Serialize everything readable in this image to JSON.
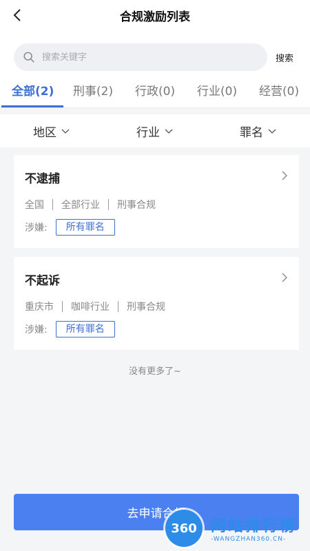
{
  "header": {
    "title": "合规激励列表",
    "back_icon": "chevron-left-icon"
  },
  "search": {
    "placeholder": "搜索关键字",
    "value": "",
    "button_label": "搜索",
    "icon": "search-icon"
  },
  "tabs": [
    {
      "label": "全部(2)",
      "active": true
    },
    {
      "label": "刑事(2)",
      "active": false
    },
    {
      "label": "行政(0)",
      "active": false
    },
    {
      "label": "行业(0)",
      "active": false
    },
    {
      "label": "经营(0)",
      "active": false
    }
  ],
  "filters": [
    {
      "label": "地区",
      "icon": "chevron-down-icon"
    },
    {
      "label": "行业",
      "icon": "chevron-down-icon"
    },
    {
      "label": "罪名",
      "icon": "chevron-down-icon"
    }
  ],
  "cards": [
    {
      "title": "不逮捕",
      "tags": [
        "全国",
        "全部行业",
        "刑事合规"
      ],
      "crime_label": "涉嫌:",
      "crime_value": "所有罪名"
    },
    {
      "title": "不起诉",
      "tags": [
        "重庆市",
        "咖啡行业",
        "刑事合规"
      ],
      "crime_label": "涉嫌:",
      "crime_value": "所有罪名"
    }
  ],
  "list_end_text": "没有更多了~",
  "apply_button": {
    "label": "去申请合规"
  },
  "watermark": {
    "badge": "360",
    "text": "网站排行榜",
    "sub": "-WANGZHAN360.CN-"
  },
  "colors": {
    "accent": "#3b6fd4",
    "button": "#4a80f0",
    "background": "#f4f5f7"
  }
}
